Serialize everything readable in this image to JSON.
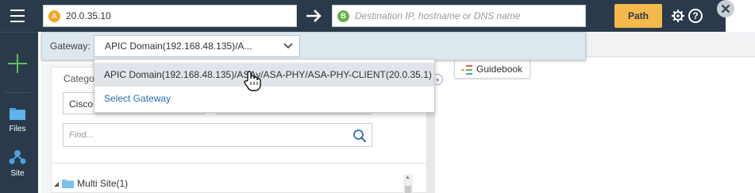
{
  "sidebar": {
    "items": [
      {
        "label": "Files",
        "icon": "folder-icon"
      },
      {
        "label": "Site",
        "icon": "site-icon"
      }
    ]
  },
  "topbar": {
    "source": {
      "badge": "A",
      "value": "20.0.35.10",
      "badge_color": "#f5a623"
    },
    "destination": {
      "badge": "B",
      "placeholder": "Destination IP, hostname or DNS name",
      "badge_color": "#6ab04c"
    },
    "path_button": "Path"
  },
  "gateway": {
    "label": "Gateway:",
    "selected": "APIC Domain(192.168.48.135)/A...",
    "options": [
      "APIC Domain(192.168.48.135)/ASAv/ASA-PHY/ASA-PHY-CLIENT(20.0.35.1)",
      "Select Gateway"
    ]
  },
  "left_panel": {
    "category_label": "Catego",
    "vendor_value": "Cisco",
    "find_placeholder": "Find...",
    "tree": [
      {
        "label": "Multi Site(1)"
      }
    ]
  },
  "guidebook": {
    "label": "Guidebook"
  },
  "colors": {
    "rail": "#2b3a4a",
    "accent": "#f5b84a",
    "link": "#2a6db5"
  }
}
